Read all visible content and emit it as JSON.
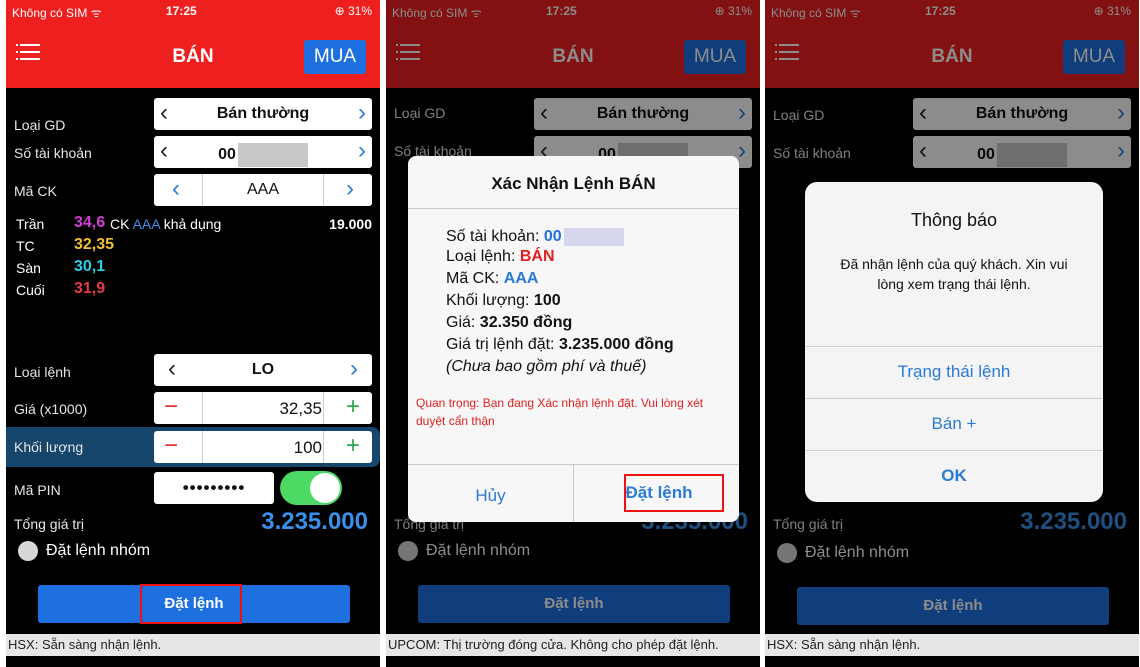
{
  "status": {
    "carrier": "Không có SIM ᯤ",
    "time": "17:25",
    "battery": "⊕ 31%"
  },
  "nav": {
    "title": "BÁN",
    "buy_label": "MUA"
  },
  "form": {
    "order_type_label": "Loại GD",
    "order_type_value": "Bán thường",
    "account_label": "Số tài khoản",
    "account_value": "00",
    "symbol_label": "Mã CK",
    "symbol_value": "AAA",
    "ceiling_label": "Trần",
    "ceiling_value": "34,6",
    "available_prefix": "CK",
    "available_symbol": "AAA",
    "available_suffix": "khả dụng",
    "available_qty": "19.000",
    "ref_label": "TC",
    "ref_value": "32,35",
    "floor_label": "Sàn",
    "floor_value": "30,1",
    "last_label": "Cuối",
    "last_value": "31,9",
    "order_kind_label": "Loại lệnh",
    "order_kind_value": "LO",
    "price_label": "Giá (x1000)",
    "price_value": "32,35",
    "qty_label": "Khối lượng",
    "qty_value": "100",
    "pin_label": "Mã PIN",
    "pin_value": "•••••••••",
    "total_label": "Tổng giá trị",
    "total_value": "3.235.000",
    "group_label": "Đặt lệnh nhóm",
    "submit_label": "Đặt lệnh",
    "minus": "−",
    "plus": "+"
  },
  "footers": {
    "hsx": "HSX: Sẵn sàng nhận lệnh.",
    "upcom": "UPCOM: Thị trường đóng cửa. Không cho phép đặt lệnh."
  },
  "confirm_dialog": {
    "title": "Xác Nhận Lệnh BÁN",
    "account_label": "Số tài khoản:",
    "account_value": "00",
    "type_label": "Loại lệnh:",
    "type_value": "BÁN",
    "symbol_label": "Mã CK:",
    "symbol_value": "AAA",
    "qty_label": "Khối lượng:",
    "qty_value": "100",
    "price_label": "Giá:",
    "price_value": "32.350 đồng",
    "value_label": "Giá trị lệnh đặt:",
    "value_value": "3.235.000 đồng",
    "note": "(Chưa bao gồm phí và thuế)",
    "warning": "Quan trọng: Bạn đang Xác nhận lệnh đặt. Vui lòng xét duyệt cẩn thận",
    "cancel_label": "Hủy",
    "ok_label": "Đặt lệnh"
  },
  "notice_dialog": {
    "title": "Thông báo",
    "message": "Đã nhận lệnh của quý khách. Xin vui lòng xem trạng thái lệnh.",
    "btn_status": "Trạng thái lệnh",
    "btn_sell_more": "Bán +",
    "btn_ok": "OK"
  },
  "colors": {
    "header_red": "#ee1f1f",
    "accent_blue": "#1e6fe0",
    "ceiling_magenta": "#d63bd6",
    "ref_yellow": "#f2c12e",
    "floor_cyan": "#26d0e8",
    "last_red": "#e8394a"
  }
}
